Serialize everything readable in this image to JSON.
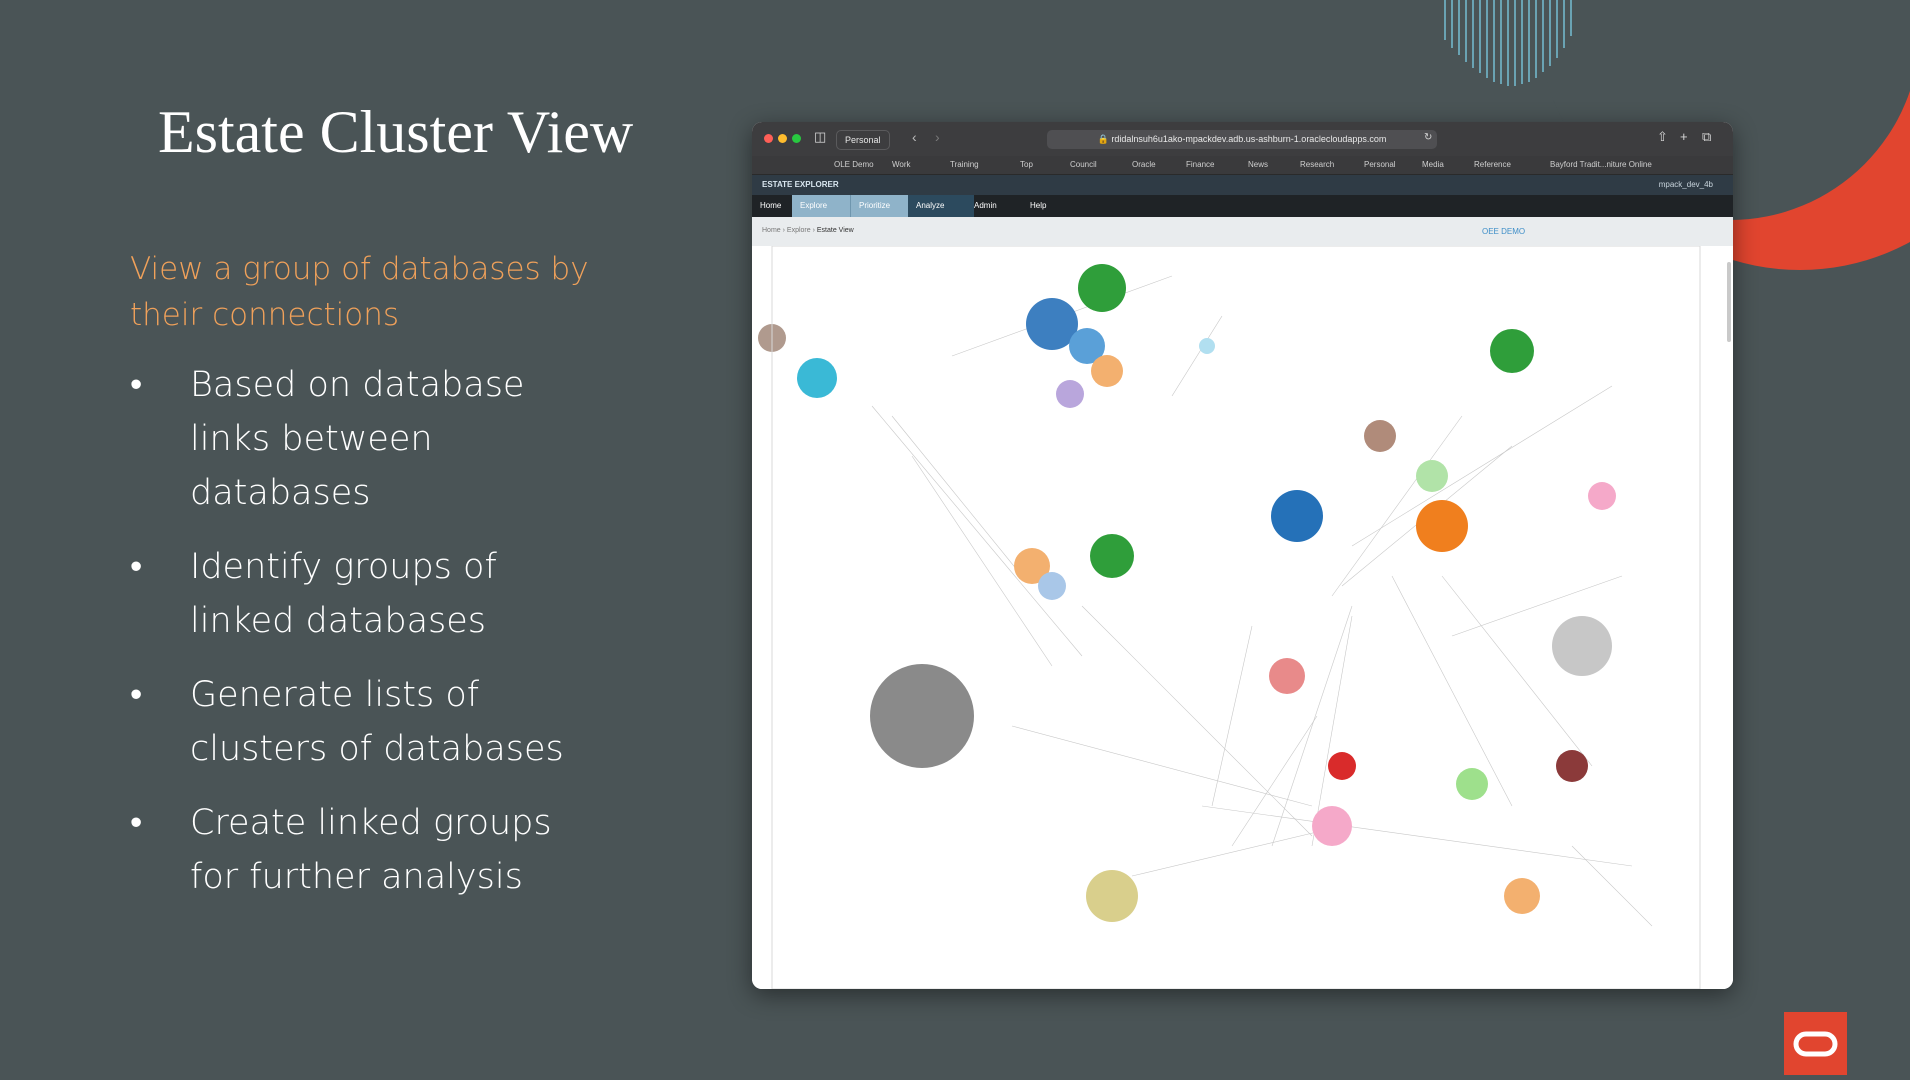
{
  "slide": {
    "title": "Estate Cluster View",
    "subtitle": "View a group of databases by their connections",
    "bullets": [
      "Based on database links between databases",
      "Identify groups of linked databases",
      "Generate lists of clusters of databases",
      "Create linked groups for further analysis"
    ],
    "bullet_glyph": "•"
  },
  "browser": {
    "profile": "Personal",
    "url": "rdidalnsuh6u1ako-mpackdev.adb.us-ashburn-1.oraclecloudapps.com",
    "bookmarks": [
      "OLE Demo",
      "Work",
      "Training",
      "Top",
      "Council",
      "Oracle",
      "Finance",
      "News",
      "Research",
      "Personal",
      "Media",
      "Reference",
      "Bayford Tradit...niture Online"
    ]
  },
  "app": {
    "name": "ESTATE EXPLORER",
    "user": "mpack_dev_4b",
    "menu": [
      "Home",
      "Explore",
      "Prioritize",
      "Analyze",
      "Admin",
      "Help"
    ],
    "breadcrumb": [
      "Home",
      "Explore",
      "Estate View"
    ],
    "demo_label": "OEE DEMO"
  },
  "colors": {
    "background": "#4a5456",
    "accent_orange": "#f0a15a",
    "oracle_red": "#e1452f",
    "menu_active": "#8fb3c9"
  },
  "icons": [
    "sidebar-icon",
    "back-icon",
    "forward-icon",
    "lock-icon",
    "reload-icon",
    "share-icon",
    "new-tab-icon",
    "tabs-icon",
    "oracle-logo"
  ]
}
